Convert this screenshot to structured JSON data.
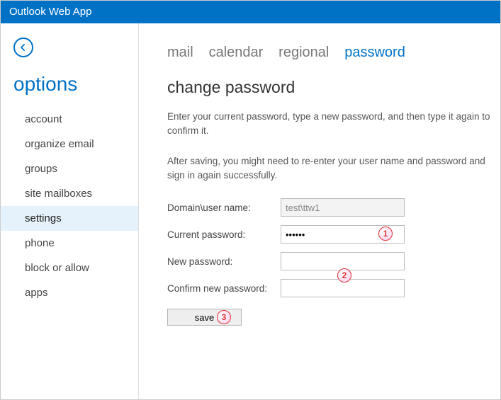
{
  "app": {
    "title": "Outlook Web App"
  },
  "sidebar": {
    "heading": "options",
    "items": [
      {
        "label": "account"
      },
      {
        "label": "organize email"
      },
      {
        "label": "groups"
      },
      {
        "label": "site mailboxes"
      },
      {
        "label": "settings"
      },
      {
        "label": "phone"
      },
      {
        "label": "block or allow"
      },
      {
        "label": "apps"
      }
    ],
    "active_index": 4
  },
  "tabs": {
    "items": [
      {
        "label": "mail"
      },
      {
        "label": "calendar"
      },
      {
        "label": "regional"
      },
      {
        "label": "password"
      }
    ],
    "active_index": 3
  },
  "page": {
    "heading": "change password",
    "desc1": "Enter your current password, type a new password, and then type it again to confirm it.",
    "desc2": "After saving, you might need to re-enter your user name and password and sign in again successfully."
  },
  "form": {
    "domain_label": "Domain\\user name:",
    "domain_value": "test\\ttw1",
    "current_label": "Current password:",
    "current_value": "••••••",
    "new_label": "New password:",
    "new_value": "",
    "confirm_label": "Confirm new password:",
    "confirm_value": "",
    "save_label": "save"
  },
  "markers": {
    "m1": "1",
    "m2": "2",
    "m3": "3"
  }
}
